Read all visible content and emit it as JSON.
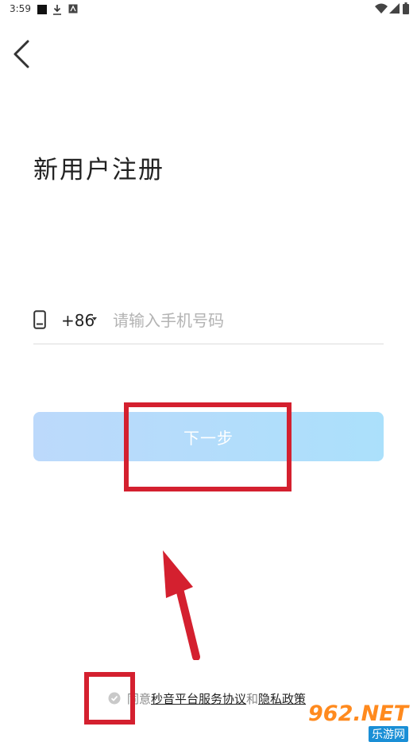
{
  "status_bar": {
    "time": "3:59",
    "left_icons": [
      "notification-square-icon",
      "download-icon",
      "app-notification-icon"
    ],
    "right_icons": [
      "wifi-icon",
      "signal-icon",
      "battery-icon"
    ]
  },
  "nav": {
    "back_icon": "chevron-left-icon"
  },
  "page": {
    "title": "新用户注册"
  },
  "phone": {
    "icon": "mobile-phone-icon",
    "country_code": "+86",
    "placeholder": "请输入手机号码",
    "value": ""
  },
  "next_button": {
    "label": "下一步"
  },
  "agreement": {
    "prefix": "同意",
    "service_link": "秒音平台服务协议",
    "joiner": "和",
    "privacy_link": "隐私政策"
  },
  "watermark": {
    "logo": "962.NET",
    "sub": "乐游网"
  },
  "colors": {
    "accent_red": "#d4202f",
    "button_gradient_start": "#bcd9fb",
    "button_gradient_end": "#abe0fb"
  }
}
